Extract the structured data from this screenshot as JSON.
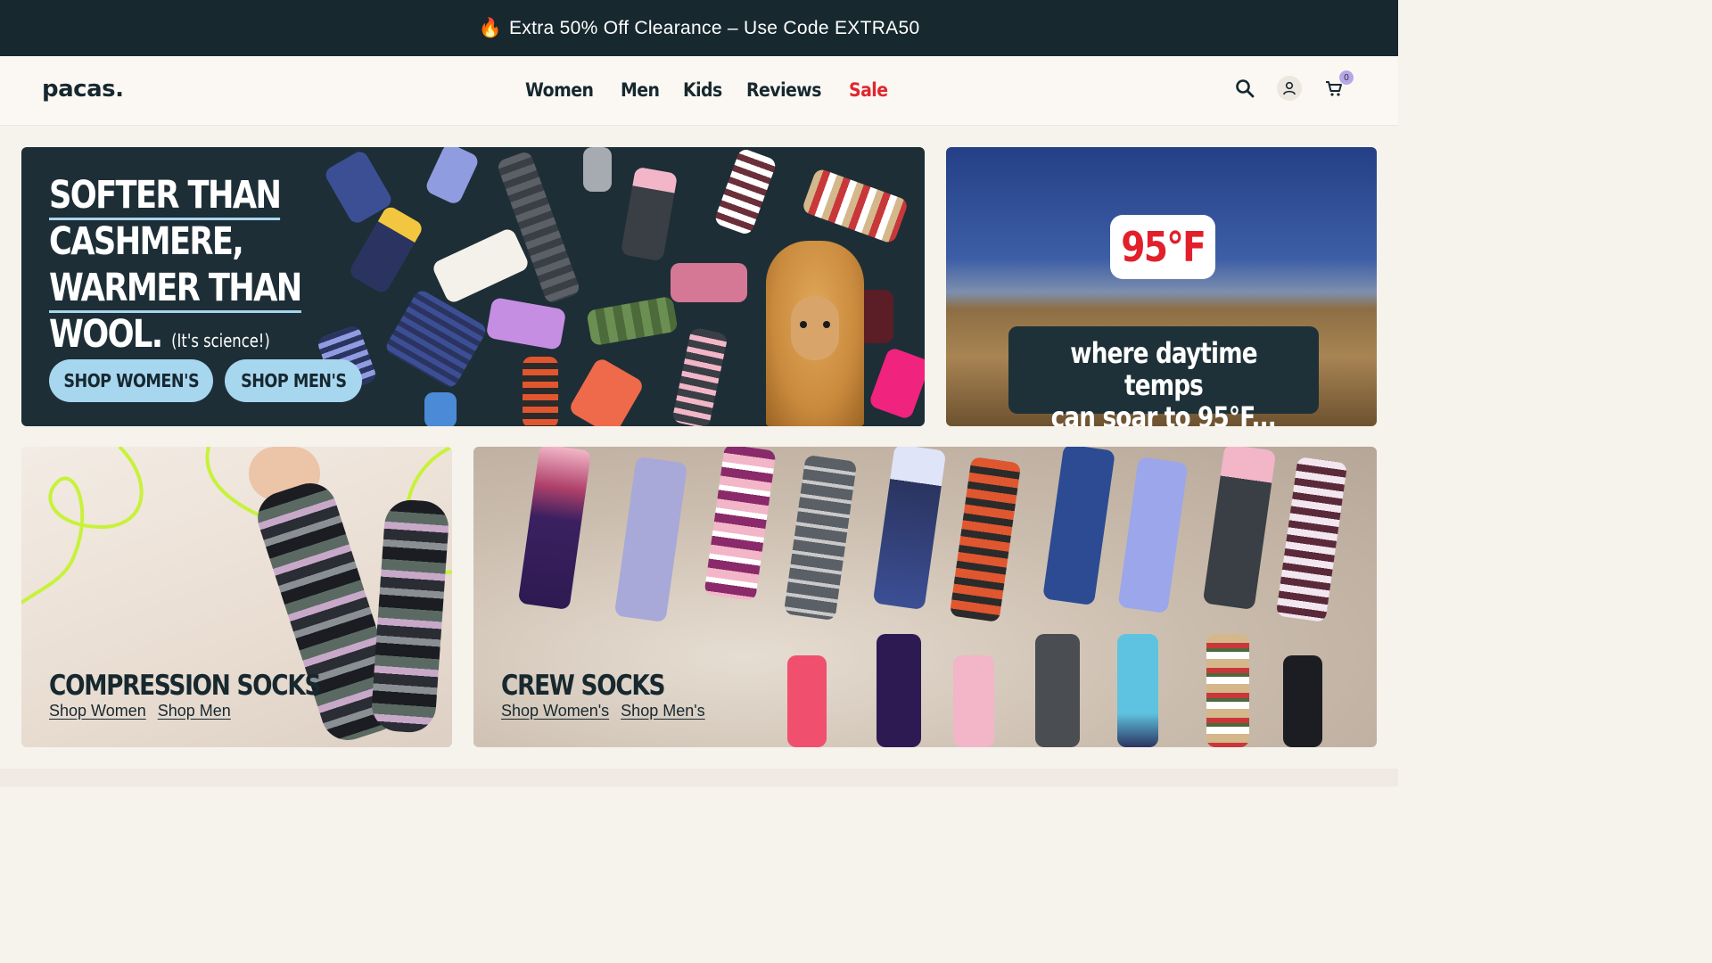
{
  "announcement": {
    "icon": "fire-icon",
    "text": "Extra 50% Off Clearance – Use Code EXTRA50"
  },
  "header": {
    "logo": "pacas.",
    "nav": [
      "Women",
      "Men",
      "Kids",
      "Reviews",
      "Sale"
    ],
    "cart_count": "0"
  },
  "hero": {
    "headline_lines": [
      "SOFTER THAN",
      "CASHMERE,",
      "WARMER THAN",
      "WOOL."
    ],
    "headline_aside": "(It's science!)",
    "shop_womens": "SHOP WOMEN'S",
    "shop_mens": "SHOP MEN'S"
  },
  "promo": {
    "temp": "95°F",
    "caption_line1": "where daytime temps",
    "caption_line2": "can soar to 95°F..."
  },
  "compression": {
    "title": "COMPRESSION SOCKS",
    "link1": "Shop Women",
    "link2": "Shop Men"
  },
  "crew": {
    "title": "CREW SOCKS",
    "link1": "Shop Women's",
    "link2": "Shop Men's"
  },
  "colors": {
    "brand_dark": "#17282f",
    "sale_red": "#e0262f",
    "pill_blue": "#a7d6ef",
    "lime_accent": "#c7f23a"
  }
}
